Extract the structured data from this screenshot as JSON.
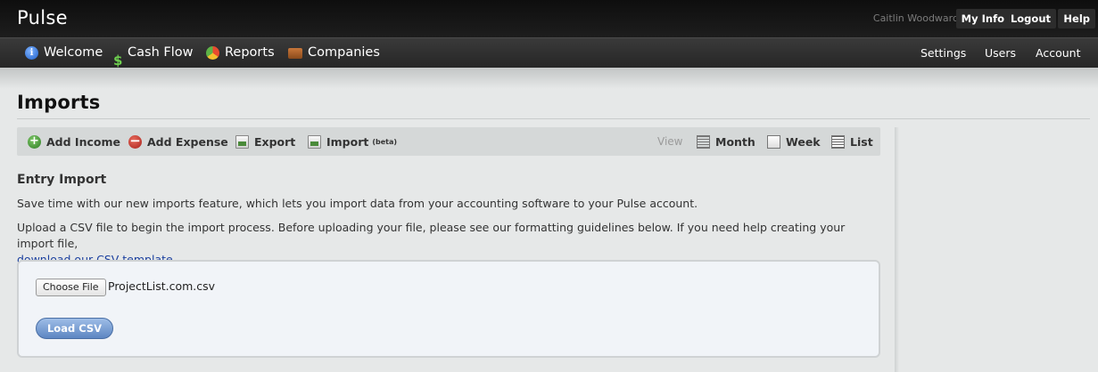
{
  "header": {
    "brand": "Pulse",
    "user_name": "Caitlin Woodward",
    "my_info": "My Info",
    "logout": "Logout",
    "help": "Help"
  },
  "nav": {
    "items": [
      {
        "label": "Welcome",
        "icon": "info-icon"
      },
      {
        "label": "Cash Flow",
        "icon": "dollar-icon"
      },
      {
        "label": "Reports",
        "icon": "pie-chart-icon"
      },
      {
        "label": "Companies",
        "icon": "briefcase-icon"
      }
    ],
    "right": [
      "Settings",
      "Users",
      "Account"
    ]
  },
  "page": {
    "title": "Imports"
  },
  "toolbar": {
    "add_income": "Add Income",
    "add_expense": "Add Expense",
    "export": "Export",
    "import": "Import",
    "beta": "(beta)",
    "view_label": "View",
    "month": "Month",
    "week": "Week",
    "list": "List"
  },
  "content": {
    "heading": "Entry Import",
    "para1": "Save time with our new imports feature, which lets you import data from your accounting software to your Pulse account.",
    "para2": "Upload a CSV file to begin the import process. Before uploading your file, please see our formatting guidelines below. If you need help creating your import file,",
    "template_link": "download our CSV template",
    "para2_end": "."
  },
  "upload": {
    "choose_file": "Choose File",
    "file_name": "ProjectList.com.csv",
    "load_button": "Load CSV"
  }
}
